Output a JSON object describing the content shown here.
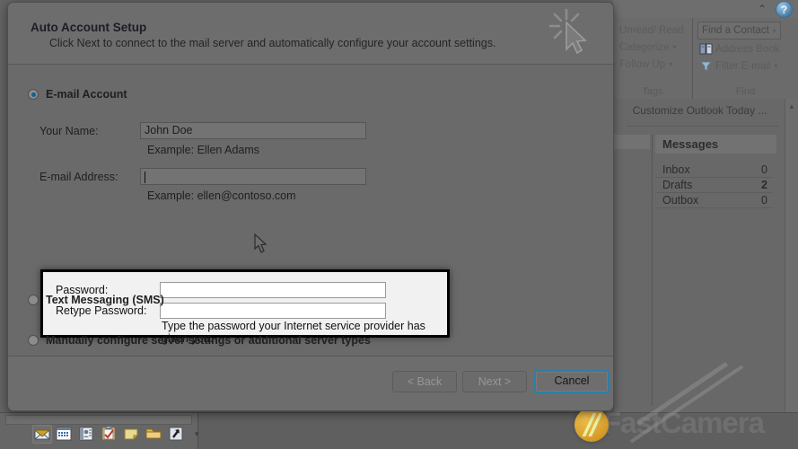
{
  "dialog": {
    "title": "Auto Account Setup",
    "subtitle": "Click Next to connect to the mail server and automatically configure your account settings.",
    "options": {
      "email_account": "E-mail Account",
      "text_messaging": "Text Messaging (SMS)",
      "manual_config": "Manually configure server settings or additional server types"
    },
    "fields": {
      "your_name_label": "Your Name:",
      "your_name_value": "John Doe",
      "your_name_hint": "Example: Ellen Adams",
      "email_label": "E-mail Address:",
      "email_value": "",
      "email_hint": "Example: ellen@contoso.com"
    },
    "password_box": {
      "password_label": "Password:",
      "password_value": "",
      "retype_label": "Retype Password:",
      "retype_value": "",
      "note": "Type the password your Internet service provider has given you."
    },
    "buttons": {
      "back": "< Back",
      "next": "Next >",
      "cancel": "Cancel"
    },
    "accent_color": "#2d7ea8",
    "highlight_border_color": "#000000"
  },
  "outlook": {
    "ribbon": {
      "help_glyph": "?",
      "collapse_glyph": "⌃",
      "groups": [
        {
          "label": "Tags",
          "items": [
            {
              "label": "Unread/ Read",
              "caret": ""
            },
            {
              "label": "Categorize",
              "caret": "▾"
            },
            {
              "label": "Follow Up",
              "caret": "▾"
            }
          ]
        },
        {
          "label": "Find",
          "items": [
            {
              "label": "Find a Contact",
              "caret": "▾"
            },
            {
              "label": "Address Book",
              "caret": ""
            },
            {
              "label": "Filter E-mail",
              "caret": "▾"
            }
          ]
        }
      ]
    },
    "today": {
      "customize_link": "Customize Outlook Today ...",
      "messages_title": "Messages",
      "rows": [
        {
          "name": "Inbox",
          "count": "0",
          "bold": false
        },
        {
          "name": "Drafts",
          "count": "2",
          "bold": true
        },
        {
          "name": "Outbox",
          "count": "0",
          "bold": false
        }
      ],
      "scroll_up_glyph": "▲",
      "scroll_down_glyph": "▼"
    },
    "nav_icons": [
      "mail-icon",
      "calendar-icon",
      "contacts-icon",
      "tasks-icon",
      "notes-icon",
      "folder-list-icon",
      "shortcuts-icon"
    ],
    "nav_overflow_glyph": "▾"
  },
  "watermark": {
    "text": "FastCamera"
  }
}
